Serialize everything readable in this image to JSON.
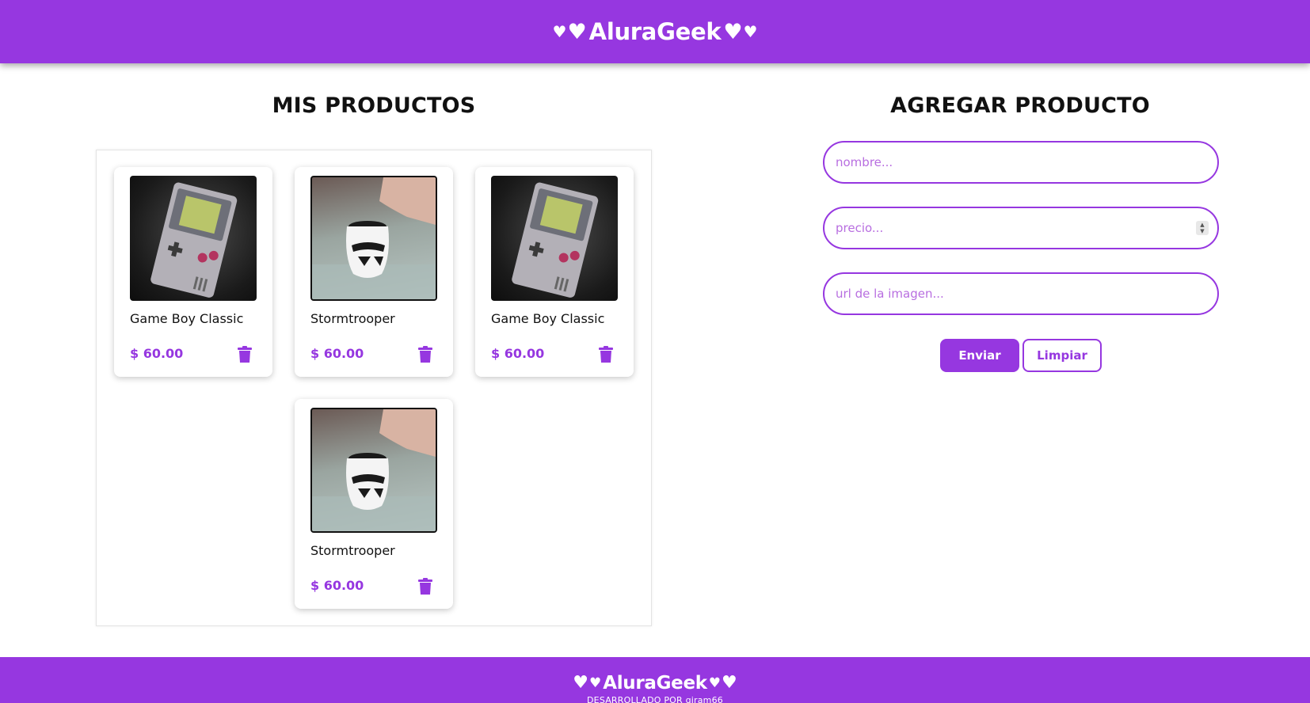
{
  "header": {
    "brand": "AluraGeek",
    "hearts": "♥"
  },
  "products_section": {
    "title": "MIS PRODUCTOS",
    "products": [
      {
        "name": "Game Boy Classic",
        "price": "$ 60.00",
        "image": "game-boy-image"
      },
      {
        "name": "Stormtrooper",
        "price": "$ 60.00",
        "image": "stormtrooper-mug-image"
      },
      {
        "name": "Game Boy Classic",
        "price": "$ 60.00",
        "image": "game-boy-image"
      },
      {
        "name": "Stormtrooper",
        "price": "$ 60.00",
        "image": "stormtrooper-mug-image"
      }
    ],
    "delete_icon": "trash-icon"
  },
  "form": {
    "title": "AGREGAR PRODUCTO",
    "name_placeholder": "nombre...",
    "price_placeholder": "precio...",
    "url_placeholder": "url de la imagen...",
    "submit_label": "Enviar",
    "clear_label": "Limpiar"
  },
  "footer": {
    "brand": "AluraGeek",
    "credit": "DESARROLLADO POR giram66"
  },
  "colors": {
    "primary": "#9637e0",
    "text": "#111111",
    "background": "#ffffff"
  }
}
